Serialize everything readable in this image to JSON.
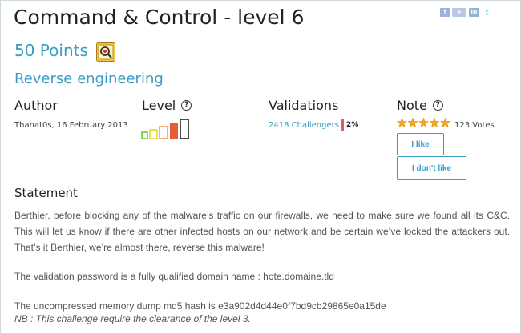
{
  "page": {
    "title": "Command & Control - level 6",
    "points": "50 Points",
    "category": "Reverse engineering"
  },
  "social": [
    "facebook-icon",
    "google-plus-icon",
    "linkedin-icon",
    "twitter-icon"
  ],
  "columns": {
    "author": {
      "label": "Author",
      "info": "Thanat0s,  16 February 2013"
    },
    "level": {
      "label": "Level",
      "help_icon": "help-circle-icon",
      "difficulty_current": 4,
      "difficulty_max": 5
    },
    "validations": {
      "label": "Validations",
      "challengers": "2418 Challengers",
      "percent": "2%"
    },
    "note": {
      "label": "Note",
      "help_icon": "help-circle-icon",
      "rating": 5,
      "votes": "123 Votes",
      "like_label": "I like",
      "dislike_label": "I don't like"
    }
  },
  "statement": {
    "title": "Statement",
    "paragraph1": "Berthier, before blocking any of the malware’s traffic on our firewalls, we need to make sure we found all its C&C. This will let us know if there are other infected hosts on our network and be certain we’ve locked the attackers out. That’s it Berthier, we’re almost there, reverse this malware!",
    "paragraph2": "The validation password is a fully qualified domain name : hote.domaine.tld",
    "paragraph3": "The uncompressed memory dump md5 hash is e3a902d4d44e0f7bd9cb29865e0a15de",
    "note": "NB : This challenge require the clearance of the level 3."
  },
  "colors": {
    "accent": "#3b9cc4",
    "star": "#f5a623",
    "level_colors": [
      "#66cc33",
      "#e8d92b",
      "#f39c52",
      "#e85a3a",
      "#222222"
    ]
  }
}
